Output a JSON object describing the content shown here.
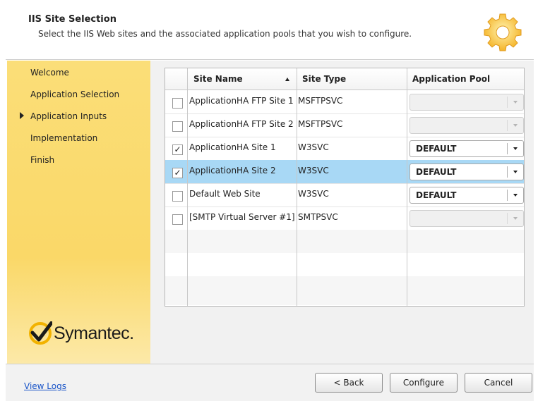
{
  "header": {
    "title": "IIS Site Selection",
    "subtitle": "Select the IIS Web sites and the associated application pools that you wish to configure.",
    "icon": "gear-icon"
  },
  "sidebar": {
    "items": [
      {
        "label": "Welcome",
        "current": false
      },
      {
        "label": "Application Selection",
        "current": false
      },
      {
        "label": "Application Inputs",
        "current": true
      },
      {
        "label": "Implementation",
        "current": false
      },
      {
        "label": "Finish",
        "current": false
      }
    ],
    "logo_text": "Symantec."
  },
  "table": {
    "columns": [
      "Site Name",
      "Site Type",
      "Application Pool"
    ],
    "sort_column": "Site Name",
    "sort_direction": "ascending",
    "rows": [
      {
        "checked": false,
        "site_name": "ApplicationHA FTP Site 1",
        "site_type": "MSFTPSVC",
        "app_pool": "",
        "pool_enabled": false,
        "selected": false
      },
      {
        "checked": false,
        "site_name": "ApplicationHA FTP Site 2",
        "site_type": "MSFTPSVC",
        "app_pool": "",
        "pool_enabled": false,
        "selected": false
      },
      {
        "checked": true,
        "site_name": "ApplicationHA Site 1",
        "site_type": "W3SVC",
        "app_pool": "DEFAULT",
        "pool_enabled": true,
        "selected": false
      },
      {
        "checked": true,
        "site_name": "ApplicationHA Site 2",
        "site_type": "W3SVC",
        "app_pool": "DEFAULT",
        "pool_enabled": true,
        "selected": true
      },
      {
        "checked": false,
        "site_name": "Default Web Site",
        "site_type": "W3SVC",
        "app_pool": "DEFAULT",
        "pool_enabled": true,
        "selected": false
      },
      {
        "checked": false,
        "site_name": "[SMTP Virtual Server #1]",
        "site_type": "SMTPSVC",
        "app_pool": "",
        "pool_enabled": false,
        "selected": false
      }
    ]
  },
  "footer": {
    "view_logs": "View Logs",
    "back": "< Back",
    "configure": "Configure",
    "cancel": "Cancel"
  },
  "colors": {
    "sidebar": "#fad868",
    "selected_row": "#a8d8f5",
    "link": "#1a55c8"
  }
}
